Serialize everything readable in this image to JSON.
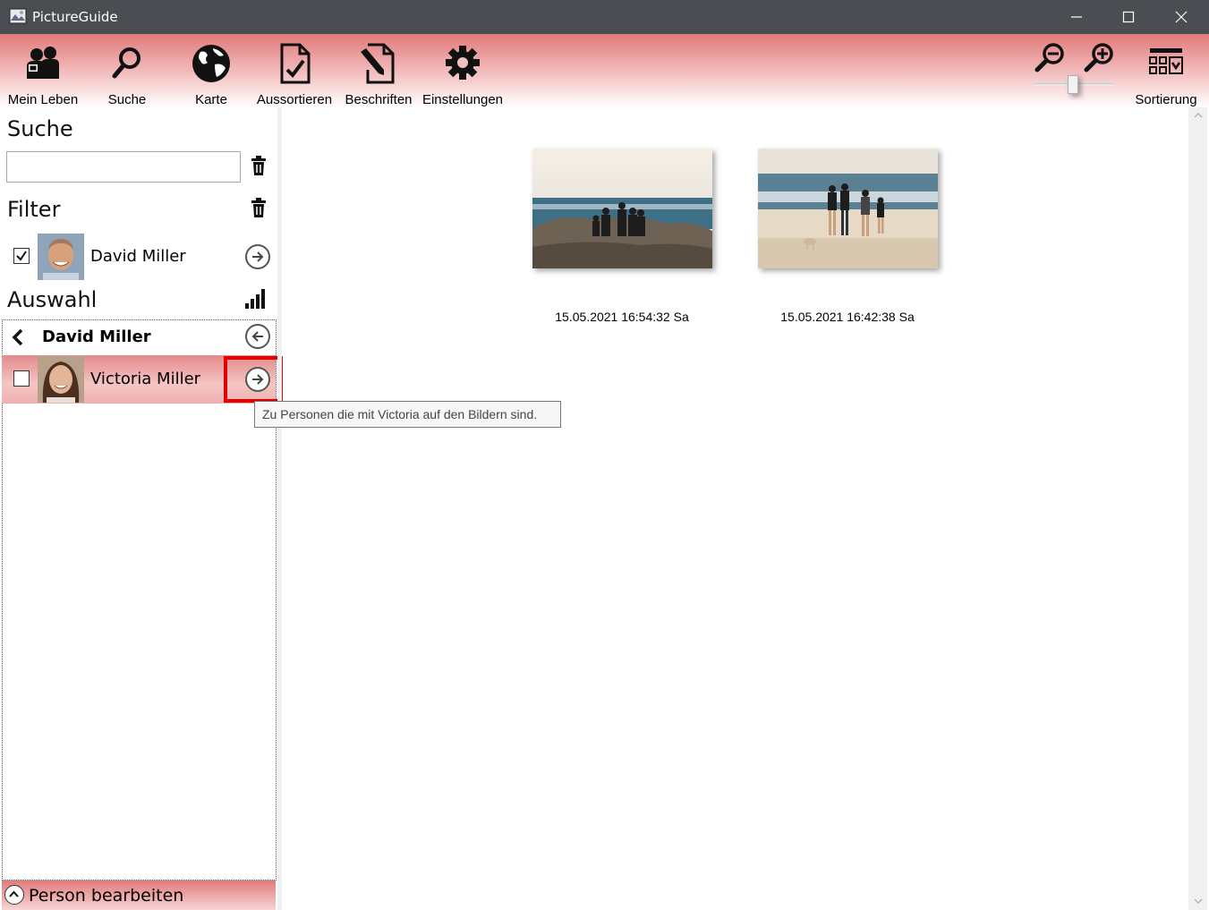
{
  "window": {
    "title": "PictureGuide"
  },
  "ribbon": {
    "buttons": [
      {
        "label": "Mein Leben",
        "icon": "people-icon"
      },
      {
        "label": "Suche",
        "icon": "search-icon"
      },
      {
        "label": "Karte",
        "icon": "globe-icon"
      },
      {
        "label": "Aussortieren",
        "icon": "sort-out-document-icon"
      },
      {
        "label": "Beschriften",
        "icon": "label-document-icon"
      },
      {
        "label": "Einstellungen",
        "icon": "gear-icon"
      }
    ],
    "sort_label": "Sortierung",
    "zoom_slider_fraction": 0.5
  },
  "left": {
    "search_title": "Suche",
    "search_value": "",
    "filter_title": "Filter",
    "filter_person": {
      "name": "David Miller",
      "checked": true
    },
    "selection_title": "Auswahl",
    "selection_back_person": "David Miller",
    "selection_person": {
      "name": "Victoria Miller",
      "checked": false
    },
    "edit_person_label": "Person bearbeiten"
  },
  "gallery": {
    "photos": [
      {
        "caption": "15.05.2021 16:54:32 Sa"
      },
      {
        "caption": "15.05.2021 16:42:38 Sa"
      }
    ]
  },
  "tooltip": "Zu Personen die mit Victoria auf den Bildern sind.",
  "colors": {
    "accent": "#e07a7a",
    "highlight_box": "#e00000",
    "titlebar": "#4a4d52"
  }
}
